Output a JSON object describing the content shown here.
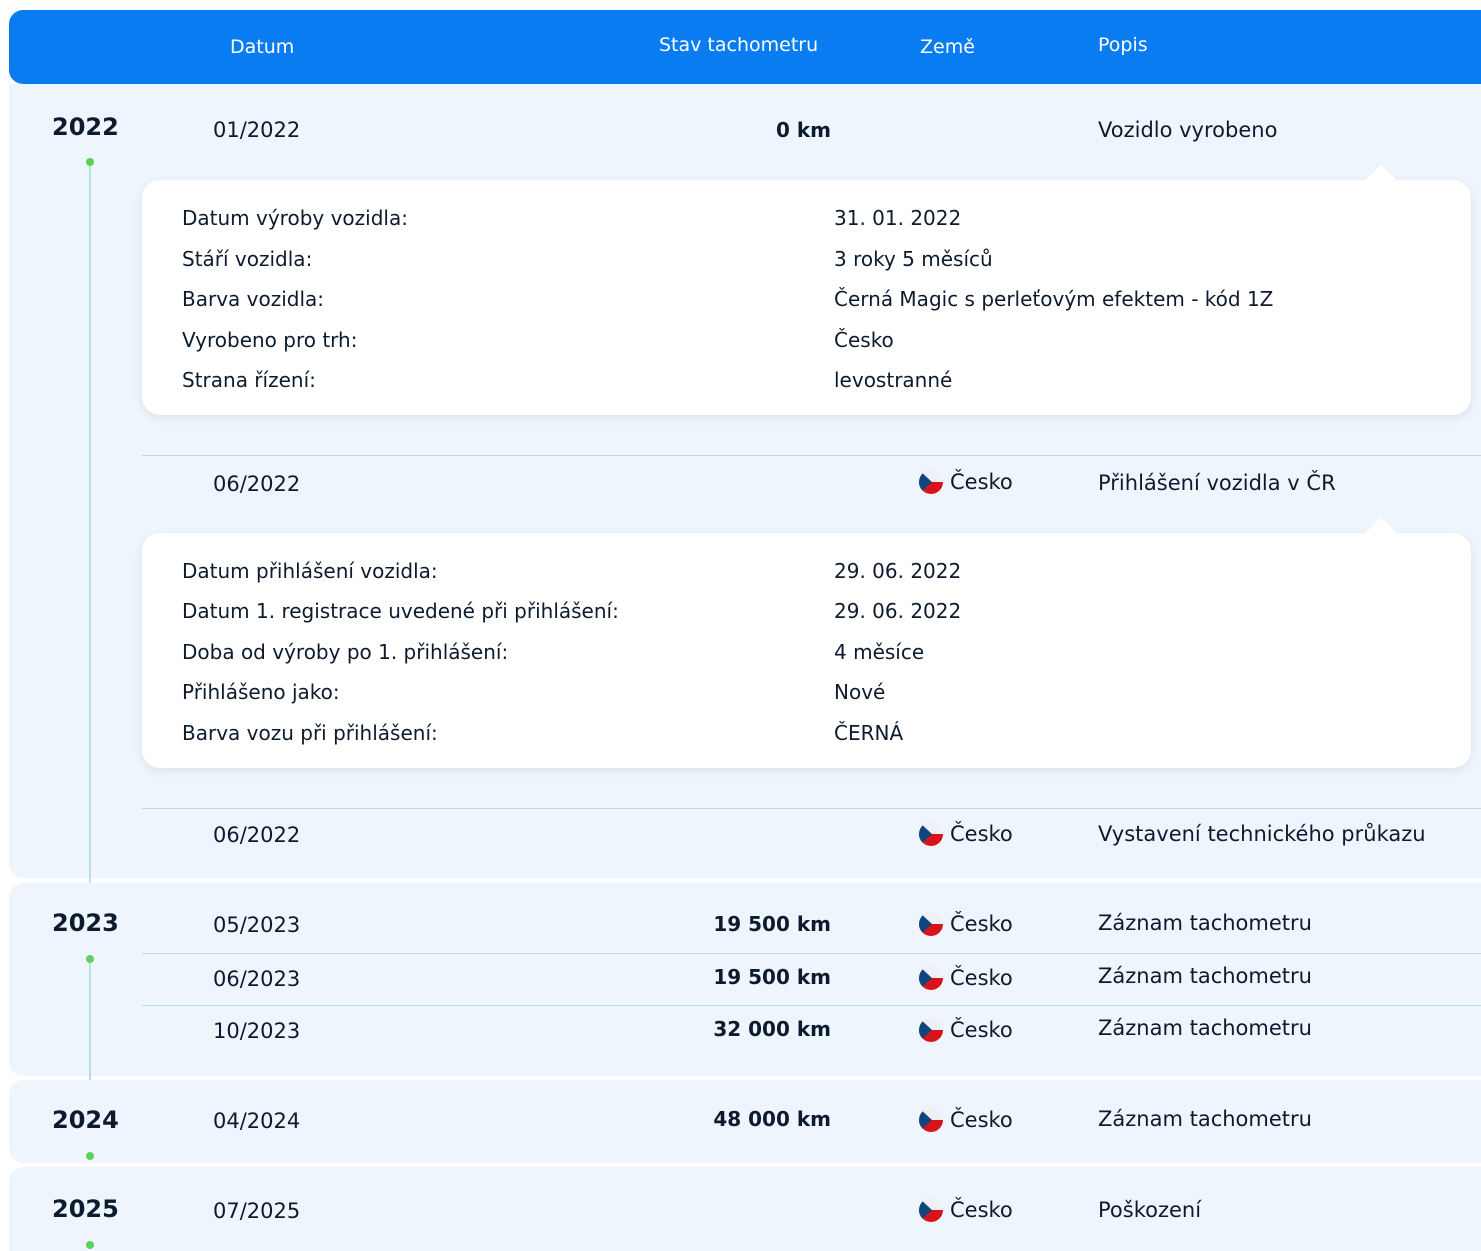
{
  "header": {
    "date": "Datum",
    "odometer": "Stav tachometru",
    "country": "Země",
    "description": "Popis"
  },
  "colors": {
    "header_bg": "#0a7cf1",
    "block_bg": "#eef5fc",
    "timeline_dot": "#5bd35b"
  },
  "years": {
    "y2022": "2022",
    "y2023": "2023",
    "y2024": "2024",
    "y2025": "2025"
  },
  "events": [
    {
      "date": "01/2022",
      "km": "0 km",
      "country": "",
      "desc": "Vozidlo vyrobeno"
    },
    {
      "date": "06/2022",
      "km": "",
      "country": "Česko",
      "desc": "Přihlášení vozidla v ČR"
    },
    {
      "date": "06/2022",
      "km": "",
      "country": "Česko",
      "desc": "Vystavení technického průkazu"
    },
    {
      "date": "05/2023",
      "km": "19 500 km",
      "country": "Česko",
      "desc": "Záznam tachometru"
    },
    {
      "date": "06/2023",
      "km": "19 500 km",
      "country": "Česko",
      "desc": "Záznam tachometru"
    },
    {
      "date": "10/2023",
      "km": "32 000 km",
      "country": "Česko",
      "desc": "Záznam tachometru"
    },
    {
      "date": "04/2024",
      "km": "48 000 km",
      "country": "Česko",
      "desc": "Záznam tachometru"
    },
    {
      "date": "07/2025",
      "km": "",
      "country": "Česko",
      "desc": "Poškození"
    }
  ],
  "details": {
    "production": [
      {
        "label": "Datum výroby vozidla:",
        "value": "31. 01. 2022"
      },
      {
        "label": "Stáří vozidla:",
        "value": "3 roky 5 měsíců"
      },
      {
        "label": "Barva vozidla:",
        "value": "Černá Magic s perleťovým efektem - kód 1Z"
      },
      {
        "label": "Vyrobeno pro trh:",
        "value": "Česko"
      },
      {
        "label": "Strana řízení:",
        "value": "levostranné"
      }
    ],
    "registration": [
      {
        "label": "Datum přihlášení vozidla:",
        "value": "29. 06. 2022"
      },
      {
        "label": "Datum 1. registrace uvedené při přihlášení:",
        "value": "29. 06. 2022"
      },
      {
        "label": "Doba od výroby po 1. přihlášení:",
        "value": "4 měsíce"
      },
      {
        "label": "Přihlášeno jako:",
        "value": "Nové"
      },
      {
        "label": "Barva vozu při přihlášení:",
        "value": "ČERNÁ"
      }
    ]
  }
}
